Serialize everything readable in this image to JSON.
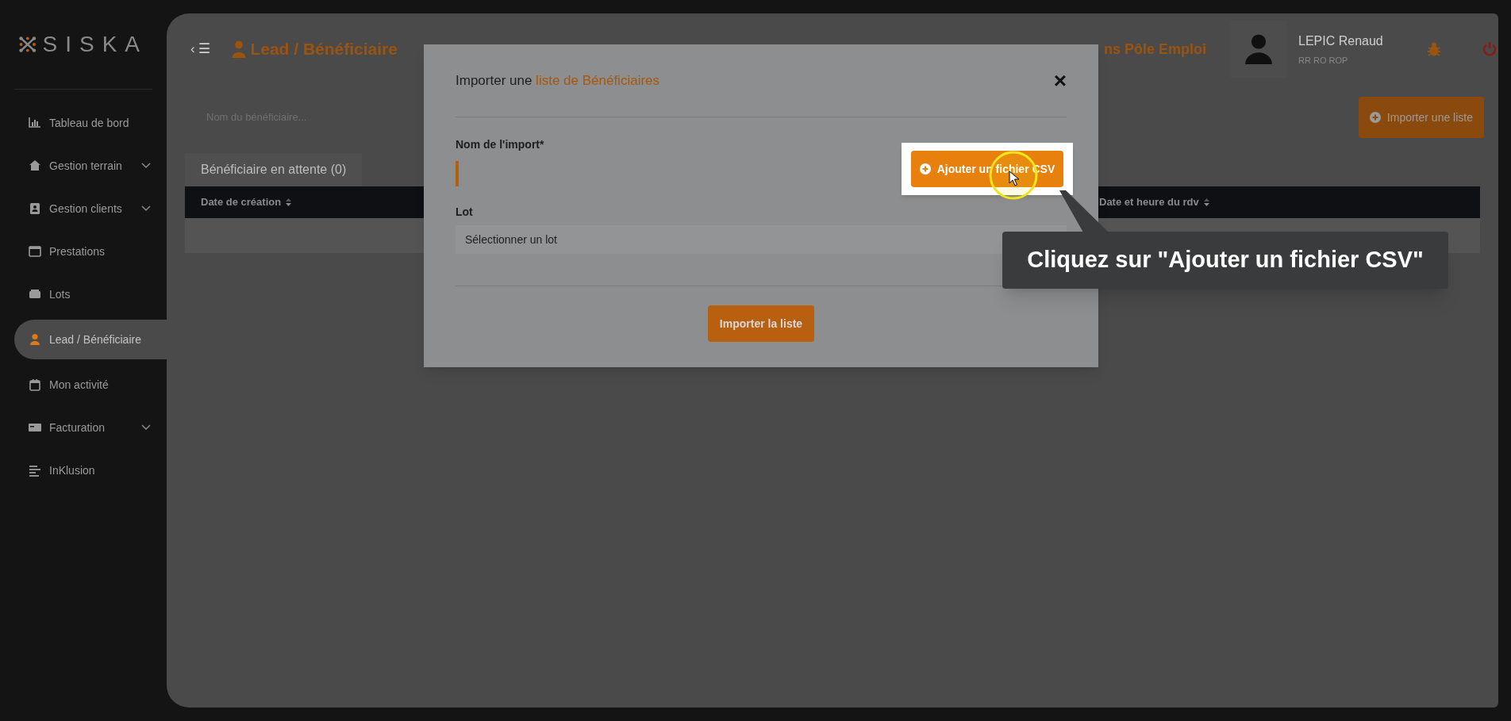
{
  "sidebar": {
    "logo": "SISKA",
    "items": [
      {
        "label": "Tableau de bord",
        "selected": false,
        "expandable": false
      },
      {
        "label": "Gestion terrain",
        "selected": false,
        "expandable": true
      },
      {
        "label": "Gestion clients",
        "selected": false,
        "expandable": true
      },
      {
        "label": "Prestations",
        "selected": false,
        "expandable": false
      },
      {
        "label": "Lots",
        "selected": false,
        "expandable": false
      },
      {
        "label": "Lead / Bénéficiaire",
        "selected": true,
        "expandable": false
      },
      {
        "label": "Mon activité",
        "selected": false,
        "expandable": false
      },
      {
        "label": "Facturation",
        "selected": false,
        "expandable": true
      },
      {
        "label": "InKlusion",
        "selected": false,
        "expandable": false
      }
    ]
  },
  "header": {
    "collapse": "‹ ☰",
    "title": "Lead / Bénéficiaire",
    "notice": "ns Pôle Emploi",
    "user": {
      "name": "LEPIC Renaud",
      "role": "RR RO ROP"
    }
  },
  "search": {
    "placeholder": "Nom du bénéficiaire..."
  },
  "import_button": "Importer une liste",
  "tabs": [
    {
      "label": "Bénéficiaire en attente (0)",
      "selected": true
    }
  ],
  "table": {
    "columns": [
      "Date de création",
      "Date et heure du rdv"
    ]
  },
  "modal": {
    "title_prefix": "Importer une ",
    "title_highlight": "liste de Bénéficiaires",
    "close": "×",
    "name_label": "Nom de l'import*",
    "add_csv_button": "Ajouter un fichier CSV",
    "lot_label": "Lot",
    "lot_select": {
      "value": "Sélectionner un lot"
    },
    "submit": "Importer la liste"
  },
  "tooltip": "Cliquez sur \"Ajouter un fichier CSV\""
}
